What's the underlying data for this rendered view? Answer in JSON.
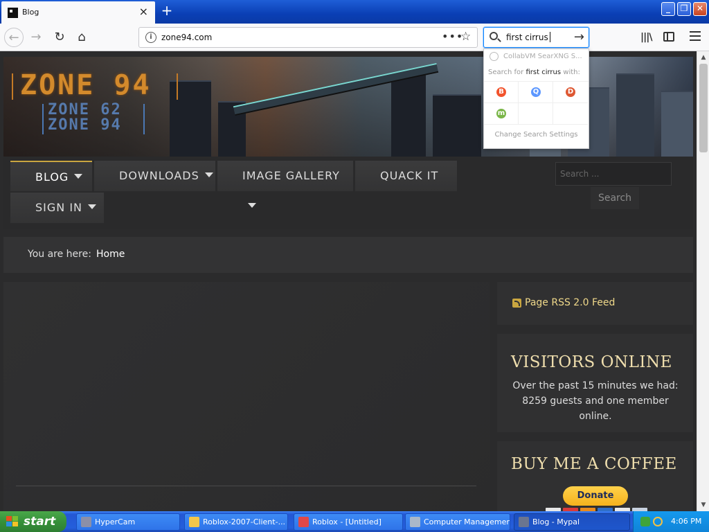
{
  "browser": {
    "tab_title": "Blog",
    "tab_close": "×",
    "new_tab": "+",
    "url": "zone94.com",
    "url_menu": "•••",
    "bookmark_star": "☆",
    "search_text": "first cirrus",
    "library_icon": "|||\\",
    "window_controls": {
      "minimize": "_",
      "maximize": "❐",
      "close": "✕"
    },
    "nav": {
      "back": "←",
      "forward": "→",
      "reload": "↻",
      "home": "⌂"
    }
  },
  "search_dropdown": {
    "suggestion": "CollabVM SearXNG S...",
    "hint_prefix": "Search for",
    "hint_query": "first cirrus",
    "hint_suffix": "with:",
    "engines": [
      {
        "name": "brave-icon",
        "glyph": "B",
        "color": "#f2542d"
      },
      {
        "name": "qwant-icon",
        "glyph": "Q",
        "color": "#5c97ff"
      },
      {
        "name": "duckduckgo-icon",
        "glyph": "D",
        "color": "#de5833"
      },
      {
        "name": "mojeek-icon",
        "glyph": "m",
        "color": "#7ab648"
      }
    ],
    "settings_label": "Change Search Settings"
  },
  "site": {
    "logo": {
      "line1": "ZONE 94",
      "line2": "ZONE 62",
      "line3": "ZONE 94"
    },
    "menu": {
      "blog": "BLOG",
      "downloads": "DOWNLOADS",
      "gallery": "IMAGE GALLERY",
      "quack": "QUACK IT",
      "signin": "SIGN IN"
    },
    "search_placeholder": "Search ...",
    "search_button": "Search",
    "breadcrumb": {
      "prefix": "You are here:",
      "current": "Home"
    },
    "sidebar": {
      "rss": "Page RSS 2.0 Feed",
      "visitors_title": "VISITORS ONLINE",
      "visitors_body": "Over the past 15 minutes we had: 8259 guests and one member online.",
      "coffee_title": "BUY ME A COFFEE",
      "donate": "Donate"
    }
  },
  "taskbar": {
    "start": "start",
    "tasks": [
      {
        "label": "HyperCam",
        "icon_color": "#8b8fa8"
      },
      {
        "label": "Roblox-2007-Client-...",
        "icon_color": "#f3c64a"
      },
      {
        "label": "Roblox - [Untitled]",
        "icon_color": "#e04848"
      },
      {
        "label": "Computer Management",
        "icon_color": "#a9b7c9"
      },
      {
        "label": "Blog - Mypal",
        "icon_color": "#6a7590"
      }
    ],
    "clock": "4:06 PM"
  }
}
